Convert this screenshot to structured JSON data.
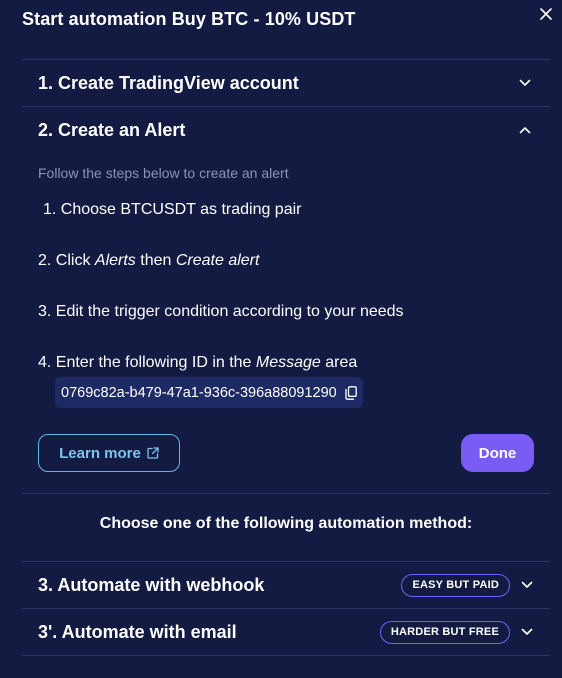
{
  "modal": {
    "title": "Start automation Buy BTC - 10% USDT",
    "close_icon": "close-icon"
  },
  "sections": {
    "create_account": {
      "label": "1. Create TradingView account",
      "expanded": false
    },
    "create_alert": {
      "label": "2. Create an Alert",
      "expanded": true,
      "subtitle": "Follow the steps below to create an alert",
      "step1": "1. Choose BTCUSDT as trading pair",
      "step2_prefix": "2. Click ",
      "step2_em1": "Alerts",
      "step2_mid": " then ",
      "step2_em2": "Create alert",
      "step3": "3. Edit the trigger condition according to your needs",
      "step4_prefix": "4. Enter the following ID in the ",
      "step4_em": "Message",
      "step4_suffix": " area",
      "alert_id": "0769c82a-b479-47a1-936c-396a88091290",
      "learn_more_label": "Learn more",
      "done_label": "Done"
    },
    "method_title": "Choose one of the following automation method:",
    "webhook": {
      "label": "3. Automate with webhook",
      "badge": "EASY BUT PAID",
      "expanded": false
    },
    "email": {
      "label": "3'. Automate with email",
      "badge": "HARDER BUT FREE",
      "expanded": false
    }
  },
  "colors": {
    "background": "#131b42",
    "divider": "#2c3563",
    "accent_purple": "#7a5cf5",
    "badge_border": "#6a63f6",
    "link_blue": "#7cc4ee",
    "muted_text": "#8b93b8",
    "id_chip_bg": "#1d2a63"
  }
}
